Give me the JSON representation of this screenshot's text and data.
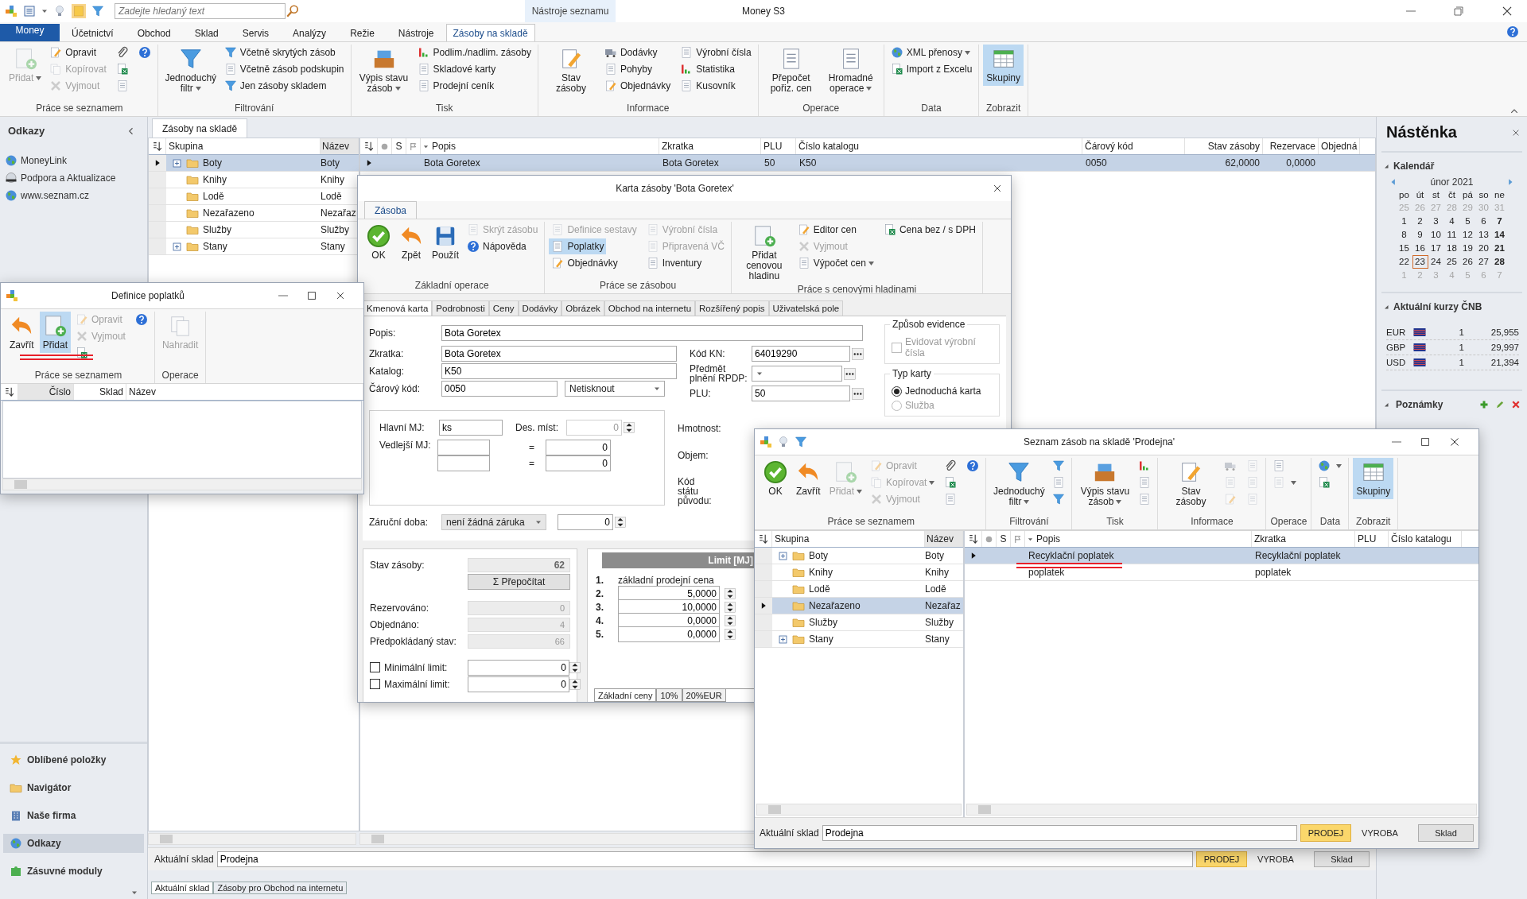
{
  "app": {
    "title": "Money S3",
    "search": {
      "placeholder": "Zadejte hledaný text"
    },
    "context_label": "Nástroje seznamu"
  },
  "menu_tabs": [
    {
      "label": "Money",
      "kind": "app",
      "selected": false
    },
    {
      "label": "Účetnictví",
      "kind": "tab",
      "selected": false
    },
    {
      "label": "Obchod",
      "kind": "tab",
      "selected": false
    },
    {
      "label": "Sklad",
      "kind": "tab",
      "selected": false
    },
    {
      "label": "Servis",
      "kind": "tab",
      "selected": false
    },
    {
      "label": "Analýzy",
      "kind": "tab",
      "selected": false
    },
    {
      "label": "Režie",
      "kind": "tab",
      "selected": false
    },
    {
      "label": "Nástroje",
      "kind": "tab",
      "selected": false
    },
    {
      "label": "Zásoby na skladě",
      "kind": "tab",
      "selected": true
    }
  ],
  "ribbon": [
    {
      "title": "Práce se seznamem",
      "items": [
        {
          "label": "Přidat",
          "kind": "add",
          "large": true,
          "disabled": true,
          "on": false,
          "dropdown": true
        },
        {
          "label": "Opravit",
          "kind": "edit",
          "large": false,
          "disabled": false,
          "on": false,
          "dropdown": false
        },
        {
          "label": "Kopírovat",
          "kind": "copy",
          "large": false,
          "disabled": true,
          "on": false,
          "dropdown": false
        },
        {
          "label": "Vyjmout",
          "kind": "cut",
          "large": false,
          "disabled": true,
          "on": false,
          "dropdown": false
        },
        {
          "kind": "clip",
          "large": false,
          "disabled": false,
          "on": false,
          "dropdown": false
        },
        {
          "kind": "excel",
          "large": false,
          "disabled": false,
          "on": false,
          "dropdown": false
        },
        {
          "kind": "page",
          "large": false,
          "disabled": false,
          "on": false,
          "dropdown": false
        },
        {
          "kind": "help",
          "large": false,
          "disabled": false,
          "on": false,
          "dropdown": false
        }
      ]
    },
    {
      "title": "Filtrování",
      "items": [
        {
          "label": "Jednoduchý filtr",
          "kind": "filter",
          "large": true,
          "disabled": false,
          "on": false,
          "dropdown": true
        },
        {
          "label": "Včetně skrytých zásob",
          "kind": "filter",
          "large": false,
          "disabled": false,
          "on": false,
          "dropdown": false
        },
        {
          "label": "Včetně zásob podskupin",
          "kind": "page",
          "large": false,
          "disabled": false,
          "on": false,
          "dropdown": false
        },
        {
          "label": "Jen zásoby skladem",
          "kind": "filter",
          "large": false,
          "disabled": false,
          "on": false,
          "dropdown": false
        }
      ]
    },
    {
      "title": "Tisk",
      "items": [
        {
          "label": "Výpis stavu zásob",
          "kind": "tray",
          "large": true,
          "disabled": false,
          "on": false,
          "dropdown": true
        },
        {
          "label": "Podlim./nadlim. zásoby",
          "kind": "chart",
          "large": false,
          "disabled": false,
          "on": false,
          "dropdown": false
        },
        {
          "label": "Skladové karty",
          "kind": "page",
          "large": false,
          "disabled": false,
          "on": false,
          "dropdown": false
        },
        {
          "label": "Prodejní ceník",
          "kind": "page",
          "large": false,
          "disabled": false,
          "on": false,
          "dropdown": false
        }
      ]
    },
    {
      "title": "Informace",
      "items": [
        {
          "label": "Stav zásoby",
          "kind": "edit",
          "large": true,
          "disabled": false,
          "on": false,
          "dropdown": false
        },
        {
          "label": "Dodávky",
          "kind": "truck",
          "large": false,
          "disabled": false,
          "on": false,
          "dropdown": false
        },
        {
          "label": "Pohyby",
          "kind": "page",
          "large": false,
          "disabled": false,
          "on": false,
          "dropdown": false
        },
        {
          "label": "Objednávky",
          "kind": "edit",
          "large": false,
          "disabled": false,
          "on": false,
          "dropdown": false
        },
        {
          "label": "Výrobní čísla",
          "kind": "page",
          "large": false,
          "disabled": false,
          "on": false,
          "dropdown": false
        },
        {
          "label": "Statistika",
          "kind": "chart",
          "large": false,
          "disabled": false,
          "on": false,
          "dropdown": false
        },
        {
          "label": "Kusovník",
          "kind": "page",
          "large": false,
          "disabled": false,
          "on": false,
          "dropdown": false
        }
      ]
    },
    {
      "title": "Operace",
      "items": [
        {
          "label": "Přepočet pořiz. cen",
          "kind": "page",
          "large": true,
          "disabled": false,
          "on": false,
          "dropdown": false
        },
        {
          "label": "Hromadné operace",
          "kind": "page",
          "large": true,
          "disabled": false,
          "on": false,
          "dropdown": true
        }
      ]
    },
    {
      "title": "Data",
      "items": [
        {
          "label": "XML přenosy",
          "kind": "globe",
          "large": false,
          "disabled": false,
          "on": false,
          "dropdown": true
        },
        {
          "label": "Import z Excelu",
          "kind": "excel",
          "large": false,
          "disabled": false,
          "on": false,
          "dropdown": false
        }
      ]
    },
    {
      "title": "Zobrazit",
      "items": [
        {
          "label": "Skupiny",
          "kind": "grid",
          "large": true,
          "disabled": false,
          "on": true,
          "dropdown": false
        }
      ]
    }
  ],
  "sidebar": {
    "title": "Odkazy",
    "links": [
      {
        "label": "MoneyLink",
        "kind": "web"
      },
      {
        "label": "Podpora a Aktualizace",
        "kind": "support"
      },
      {
        "label": "www.seznam.cz",
        "kind": "web"
      }
    ],
    "nav": [
      {
        "label": "Oblíbené položky",
        "kind": "favorites",
        "selected": false
      },
      {
        "label": "Navigátor",
        "kind": "navigator",
        "selected": false
      },
      {
        "label": "Naše firma",
        "kind": "company",
        "selected": false
      },
      {
        "label": "Odkazy",
        "kind": "links",
        "selected": true
      },
      {
        "label": "Zásuvné moduly",
        "kind": "plugins",
        "selected": false
      }
    ]
  },
  "main_tab": "Zásoby na skladě",
  "groups_tree": {
    "columns": [
      "Skupina",
      "Název"
    ],
    "rows": [
      {
        "name": "Boty",
        "short": "Boty",
        "expandable": true,
        "selected": true
      },
      {
        "name": "Knihy",
        "short": "Knihy",
        "expandable": false,
        "selected": false
      },
      {
        "name": "Lodě",
        "short": "Lodě",
        "expandable": false,
        "selected": false
      },
      {
        "name": "Nezařazeno",
        "short": "Nezařaz",
        "expandable": false,
        "selected": false
      },
      {
        "name": "Služby",
        "short": "Služby",
        "expandable": false,
        "selected": false
      },
      {
        "name": "Stany",
        "short": "Stany",
        "expandable": true,
        "selected": false
      }
    ]
  },
  "stock_grid": {
    "s_column": "S",
    "columns": [
      "Popis",
      "Zkratka",
      "PLU",
      "Číslo katalogu",
      "Čárový kód",
      "Stav zásoby",
      "Rezervace",
      "Objedná"
    ],
    "rows": [
      {
        "cells": [
          "Bota Goretex",
          "Bota Goretex",
          "50",
          "K50",
          "0050",
          "62,0000",
          "0,0000"
        ],
        "selected": true
      }
    ]
  },
  "footer": {
    "label": "Aktuální sklad",
    "value": "Prodejna",
    "buttons": [
      {
        "label": "PRODEJ",
        "kind": "toggle",
        "selected": true
      },
      {
        "label": "VYROBA",
        "kind": "toggle",
        "selected": false
      },
      {
        "label": "Sklad",
        "kind": "button",
        "selected": false
      }
    ]
  },
  "bottom_tabs": [
    {
      "label": "Aktuální sklad",
      "selected": true
    },
    {
      "label": "Zásoby pro Obchod na internetu",
      "selected": false
    }
  ],
  "dashboard": {
    "title": "Nástěnka",
    "calendar": {
      "title": "Kalendář",
      "month": "únor 2021",
      "weekdays": [
        "po",
        "út",
        "st",
        "čt",
        "pá",
        "so",
        "ne"
      ],
      "days": [
        {
          "n": "25",
          "muted": true,
          "today": false
        },
        {
          "n": "26",
          "muted": true,
          "today": false
        },
        {
          "n": "27",
          "muted": true,
          "today": false
        },
        {
          "n": "28",
          "muted": true,
          "today": false
        },
        {
          "n": "29",
          "muted": true,
          "today": false
        },
        {
          "n": "30",
          "muted": true,
          "today": false
        },
        {
          "n": "31",
          "muted": true,
          "today": false
        },
        {
          "n": "1",
          "muted": false,
          "today": false
        },
        {
          "n": "2",
          "muted": false,
          "today": false
        },
        {
          "n": "3",
          "muted": false,
          "today": false
        },
        {
          "n": "4",
          "muted": false,
          "today": false
        },
        {
          "n": "5",
          "muted": false,
          "today": false
        },
        {
          "n": "6",
          "muted": false,
          "today": false
        },
        {
          "n": "7",
          "muted": false,
          "today": false
        },
        {
          "n": "8",
          "muted": false,
          "today": false
        },
        {
          "n": "9",
          "muted": false,
          "today": false
        },
        {
          "n": "10",
          "muted": false,
          "today": false
        },
        {
          "n": "11",
          "muted": false,
          "today": false
        },
        {
          "n": "12",
          "muted": false,
          "today": false
        },
        {
          "n": "13",
          "muted": false,
          "today": false
        },
        {
          "n": "14",
          "muted": false,
          "today": false
        },
        {
          "n": "15",
          "muted": false,
          "today": false
        },
        {
          "n": "16",
          "muted": false,
          "today": false
        },
        {
          "n": "17",
          "muted": false,
          "today": false
        },
        {
          "n": "18",
          "muted": false,
          "today": false
        },
        {
          "n": "19",
          "muted": false,
          "today": false
        },
        {
          "n": "20",
          "muted": false,
          "today": false
        },
        {
          "n": "21",
          "muted": false,
          "today": false
        },
        {
          "n": "22",
          "muted": false,
          "today": false
        },
        {
          "n": "23",
          "muted": false,
          "today": true
        },
        {
          "n": "24",
          "muted": false,
          "today": false
        },
        {
          "n": "25",
          "muted": false,
          "today": false
        },
        {
          "n": "26",
          "muted": false,
          "today": false
        },
        {
          "n": "27",
          "muted": false,
          "today": false
        },
        {
          "n": "28",
          "muted": false,
          "today": false
        },
        {
          "n": "1",
          "muted": true,
          "today": false
        },
        {
          "n": "2",
          "muted": true,
          "today": false
        },
        {
          "n": "3",
          "muted": true,
          "today": false
        },
        {
          "n": "4",
          "muted": true,
          "today": false
        },
        {
          "n": "5",
          "muted": true,
          "today": false
        },
        {
          "n": "6",
          "muted": true,
          "today": false
        },
        {
          "n": "7",
          "muted": true,
          "today": false
        }
      ]
    },
    "rates": {
      "title": "Aktuální kurzy ČNB",
      "rows": [
        {
          "code": "EUR",
          "amount": "1",
          "rate": "25,955"
        },
        {
          "code": "GBP",
          "amount": "1",
          "rate": "29,997"
        },
        {
          "code": "USD",
          "amount": "1",
          "rate": "21,394"
        }
      ]
    },
    "notes": {
      "title": "Poznámky"
    }
  },
  "fees_window": {
    "title": "Definice poplatků",
    "ribbon": [
      {
        "title": "Práce se seznamem",
        "items": [
          {
            "label": "Zavřít",
            "kind": "back",
            "large": true,
            "disabled": false,
            "on": false,
            "dropdown": false
          },
          {
            "label": "Přidat",
            "kind": "add",
            "large": true,
            "disabled": false,
            "on": true,
            "dropdown": false
          },
          {
            "label": "Opravit",
            "kind": "edit",
            "large": false,
            "disabled": true,
            "on": false,
            "dropdown": false
          },
          {
            "label": "Vyjmout",
            "kind": "cut",
            "large": false,
            "disabled": true,
            "on": false,
            "dropdown": false
          },
          {
            "kind": "excel",
            "large": false,
            "disabled": false,
            "on": false,
            "dropdown": false
          },
          {
            "kind": "help",
            "large": false,
            "disabled": false,
            "on": false,
            "dropdown": false
          }
        ]
      },
      {
        "title": "Operace",
        "items": [
          {
            "label": "Nahradit",
            "kind": "copy",
            "large": true,
            "disabled": true,
            "on": false,
            "dropdown": false
          }
        ]
      }
    ],
    "columns": [
      "Číslo",
      "Sklad",
      "Název"
    ]
  },
  "card_window": {
    "title": "Karta zásoby 'Bota Goretex'",
    "tab": "Zásoba",
    "ribbon": [
      {
        "title": "Základní operace",
        "items": [
          {
            "label": "OK",
            "kind": "ok",
            "large": true,
            "disabled": false,
            "on": false,
            "dropdown": false
          },
          {
            "label": "Zpět",
            "kind": "back",
            "large": true,
            "disabled": false,
            "on": false,
            "dropdown": false
          },
          {
            "label": "Použít",
            "kind": "save",
            "large": true,
            "disabled": false,
            "on": false,
            "dropdown": false
          },
          {
            "label": "Skrýt zásobu",
            "kind": "page",
            "large": false,
            "disabled": true,
            "on": false,
            "dropdown": false
          },
          {
            "label": "Nápověda",
            "kind": "help",
            "large": false,
            "disabled": false,
            "on": false,
            "dropdown": false
          }
        ]
      },
      {
        "title": "Práce se zásobou",
        "items": [
          {
            "label": "Definice sestavy",
            "kind": "page",
            "large": false,
            "disabled": true,
            "on": false,
            "dropdown": false
          },
          {
            "label": "Poplatky",
            "kind": "page",
            "large": false,
            "disabled": false,
            "on": true,
            "dropdown": false
          },
          {
            "label": "Objednávky",
            "kind": "edit",
            "large": false,
            "disabled": false,
            "on": false,
            "dropdown": false
          },
          {
            "label": "Výrobní čísla",
            "kind": "page",
            "large": false,
            "disabled": true,
            "on": false,
            "dropdown": false
          },
          {
            "label": "Připravená VČ",
            "kind": "page",
            "large": false,
            "disabled": true,
            "on": false,
            "dropdown": false
          },
          {
            "label": "Inventury",
            "kind": "page",
            "large": false,
            "disabled": false,
            "on": false,
            "dropdown": false
          }
        ]
      },
      {
        "title": "Práce s cenovými hladinami",
        "items": [
          {
            "label": "Přidat cenovou hladinu",
            "kind": "add",
            "large": true,
            "disabled": false,
            "on": false,
            "dropdown": false
          },
          {
            "label": "Editor cen",
            "kind": "edit",
            "large": false,
            "disabled": false,
            "on": false,
            "dropdown": false
          },
          {
            "label": "Vyjmout",
            "kind": "cut",
            "large": false,
            "disabled": true,
            "on": false,
            "dropdown": false
          },
          {
            "label": "Výpočet cen",
            "kind": "page",
            "large": false,
            "disabled": false,
            "on": false,
            "dropdown": true
          },
          {
            "label": "Cena bez / s DPH",
            "kind": "excel",
            "large": false,
            "disabled": false,
            "on": false,
            "dropdown": false
          }
        ]
      }
    ],
    "tabs": [
      {
        "label": "Kmenová karta",
        "selected": true
      },
      {
        "label": "Podrobnosti",
        "selected": false
      },
      {
        "label": "Ceny",
        "selected": false
      },
      {
        "label": "Dodávky",
        "selected": false
      },
      {
        "label": "Obrázek",
        "selected": false
      },
      {
        "label": "Obchod na internetu",
        "selected": false
      },
      {
        "label": "Rozšířený popis",
        "selected": false
      },
      {
        "label": "Uživatelská pole",
        "selected": false
      }
    ],
    "form": {
      "popis": {
        "label": "Popis:",
        "value": "Bota Goretex"
      },
      "zkratka": {
        "label": "Zkratka:",
        "value": "Bota Goretex"
      },
      "katalog": {
        "label": "Katalog:",
        "value": "K50"
      },
      "carovy_kod": {
        "label": "Čárový kód:",
        "value": "0050",
        "print": "Netisknout"
      },
      "kod_kn": {
        "label": "Kód KN:",
        "value": "64019290"
      },
      "rpdp": {
        "label": "Předmět plnění RPDP:"
      },
      "plu": {
        "label": "PLU:",
        "value": "50"
      },
      "hlavni_mj": {
        "label": "Hlavní MJ:",
        "value": "ks"
      },
      "des_mist": {
        "label": "Des. míst:",
        "value": "0"
      },
      "vedlejsi_mj": {
        "label": "Vedlejší MJ:",
        "rows": [
          {
            "sign": "=",
            "value": "0"
          },
          {
            "sign": "=",
            "value": "0"
          }
        ]
      },
      "zarucni_doba": {
        "label": "Záruční doba:",
        "value": "není žádná záruka",
        "amount": "0"
      },
      "hmotnost": {
        "label": "Hmotnost:"
      },
      "objem": {
        "label": "Objem:"
      },
      "kod_statu": {
        "label": "Kód státu původu:"
      },
      "evidence": {
        "title": "Způsob evidence",
        "label": "Evidovat výrobní čísla",
        "checked": false,
        "disabled": true
      },
      "card_type": {
        "title": "Typ karty",
        "options": [
          {
            "label": "Jednoduchá karta",
            "selected": true,
            "disabled": false
          },
          {
            "label": "Služba",
            "selected": false,
            "disabled": true
          }
        ]
      }
    },
    "stock": {
      "label": "Stav zásoby:",
      "value": "62",
      "recalc": "Σ Přepočítat",
      "rows": [
        {
          "label": "Rezervováno:",
          "value": "0"
        },
        {
          "label": "Objednáno:",
          "value": "4"
        },
        {
          "label": "Předpokládaný stav:",
          "value": "66"
        }
      ],
      "limits": [
        {
          "label": "Minimální limit:",
          "value": "0",
          "checked": false
        },
        {
          "label": "Maximální limit:",
          "value": "0",
          "checked": false
        }
      ]
    },
    "prices": {
      "header": "Limit [MJ]",
      "rows": [
        {
          "index": "1.",
          "kind": "label",
          "text": "základní prodejní cena"
        },
        {
          "index": "2.",
          "kind": "input",
          "text": "5,0000"
        },
        {
          "index": "3.",
          "kind": "input",
          "text": "10,0000"
        },
        {
          "index": "4.",
          "kind": "input",
          "text": "0,0000"
        },
        {
          "index": "5.",
          "kind": "input",
          "text": "0,0000"
        }
      ],
      "tabs": [
        {
          "label": "Základní ceny",
          "selected": true
        },
        {
          "label": "10%",
          "selected": false
        },
        {
          "label": "20%EUR",
          "selected": false
        }
      ]
    }
  },
  "list_window": {
    "title": "Seznam zásob na skladě 'Prodejna'",
    "ribbon": [
      {
        "title": "Práce se seznamem",
        "items": [
          {
            "label": "OK",
            "kind": "ok",
            "large": true,
            "disabled": false,
            "on": false,
            "dropdown": false
          },
          {
            "label": "Zavřít",
            "kind": "back",
            "large": true,
            "disabled": false,
            "on": false,
            "dropdown": false
          },
          {
            "label": "Přidat",
            "kind": "add",
            "large": true,
            "disabled": true,
            "on": false,
            "dropdown": true
          },
          {
            "label": "Opravit",
            "kind": "edit",
            "large": false,
            "disabled": true,
            "on": false,
            "dropdown": false
          },
          {
            "label": "Kopírovat",
            "kind": "copy",
            "large": false,
            "disabled": true,
            "on": false,
            "dropdown": true
          },
          {
            "label": "Vyjmout",
            "kind": "cut",
            "large": false,
            "disabled": true,
            "on": false,
            "dropdown": false
          },
          {
            "kind": "clip",
            "large": false,
            "disabled": false,
            "on": false,
            "dropdown": false
          },
          {
            "kind": "excel",
            "large": false,
            "disabled": false,
            "on": false,
            "dropdown": false
          },
          {
            "kind": "page",
            "large": false,
            "disabled": false,
            "on": false,
            "dropdown": false
          },
          {
            "kind": "help",
            "large": false,
            "disabled": false,
            "on": false,
            "dropdown": false
          }
        ]
      },
      {
        "title": "Filtrování",
        "items": [
          {
            "label": "Jednoduchý filtr",
            "kind": "filter",
            "large": true,
            "disabled": false,
            "on": false,
            "dropdown": true
          },
          {
            "kind": "filter",
            "large": false,
            "disabled": false,
            "on": false,
            "dropdown": false
          },
          {
            "kind": "page",
            "large": false,
            "disabled": false,
            "on": false,
            "dropdown": false
          },
          {
            "kind": "filter",
            "large": false,
            "disabled": false,
            "on": false,
            "dropdown": false
          }
        ]
      },
      {
        "title": "Tisk",
        "items": [
          {
            "label": "Výpis stavu zásob",
            "kind": "tray",
            "large": true,
            "disabled": false,
            "on": false,
            "dropdown": true
          },
          {
            "kind": "chart",
            "large": false,
            "disabled": false,
            "on": false,
            "dropdown": false
          },
          {
            "kind": "page",
            "large": false,
            "disabled": false,
            "on": false,
            "dropdown": false
          },
          {
            "kind": "page",
            "large": false,
            "disabled": false,
            "on": false,
            "dropdown": false
          }
        ]
      },
      {
        "title": "Informace",
        "items": [
          {
            "label": "Stav zásoby",
            "kind": "edit",
            "large": true,
            "disabled": false,
            "on": false,
            "dropdown": false
          },
          {
            "kind": "truck",
            "large": false,
            "disabled": true,
            "on": false,
            "dropdown": false
          },
          {
            "kind": "page",
            "large": false,
            "disabled": true,
            "on": false,
            "dropdown": false
          },
          {
            "kind": "edit",
            "large": false,
            "disabled": true,
            "on": false,
            "dropdown": false
          },
          {
            "kind": "page",
            "large": false,
            "disabled": true,
            "on": false,
            "dropdown": false
          },
          {
            "kind": "page",
            "large": false,
            "disabled": true,
            "on": false,
            "dropdown": false
          },
          {
            "kind": "page",
            "large": false,
            "disabled": true,
            "on": false,
            "dropdown": false
          }
        ]
      },
      {
        "title": "Operace",
        "items": [
          {
            "kind": "page",
            "large": false,
            "disabled": false,
            "on": false,
            "dropdown": false
          },
          {
            "kind": "page",
            "large": false,
            "disabled": true,
            "on": false,
            "dropdown": true
          }
        ]
      },
      {
        "title": "Data",
        "items": [
          {
            "kind": "globe",
            "large": false,
            "disabled": false,
            "on": false,
            "dropdown": true
          },
          {
            "kind": "excel",
            "large": false,
            "disabled": false,
            "on": false,
            "dropdown": false
          }
        ]
      },
      {
        "title": "Zobrazit",
        "items": [
          {
            "label": "Skupiny",
            "kind": "grid",
            "large": true,
            "disabled": false,
            "on": true,
            "dropdown": false
          }
        ]
      }
    ],
    "tree": {
      "columns": [
        "Skupina",
        "Název"
      ],
      "rows": [
        {
          "name": "Boty",
          "short": "Boty",
          "expandable": true,
          "selected": false
        },
        {
          "name": "Knihy",
          "short": "Knihy",
          "expandable": false,
          "selected": false
        },
        {
          "name": "Lodě",
          "short": "Lodě",
          "expandable": false,
          "selected": false
        },
        {
          "name": "Nezařazeno",
          "short": "Nezařaz",
          "expandable": false,
          "selected": true
        },
        {
          "name": "Služby",
          "short": "Služby",
          "expandable": false,
          "selected": false
        },
        {
          "name": "Stany",
          "short": "Stany",
          "expandable": true,
          "selected": false
        }
      ]
    },
    "grid": {
      "s_column": "S",
      "columns": [
        "Popis",
        "Zkratka",
        "PLU",
        "Číslo katalogu"
      ],
      "rows": [
        {
          "cells": [
            "Recyklační poplatek",
            "Recyklační poplatek"
          ],
          "selected": true
        },
        {
          "cells": [
            "poplatek",
            "poplatek"
          ],
          "selected": false
        }
      ]
    },
    "footer": {
      "label": "Aktuální sklad",
      "value": "Prodejna",
      "buttons": [
        {
          "label": "PRODEJ",
          "kind": "toggle",
          "selected": true
        },
        {
          "label": "VYROBA",
          "kind": "toggle",
          "selected": false
        },
        {
          "label": "Sklad",
          "kind": "button",
          "selected": false
        }
      ]
    }
  }
}
